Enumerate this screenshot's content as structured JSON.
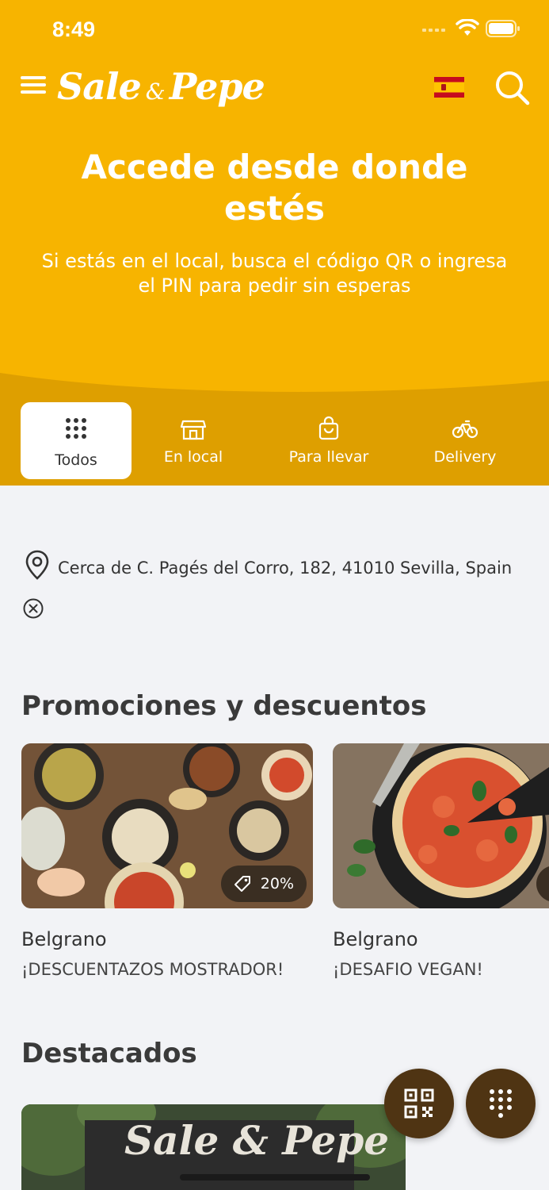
{
  "status_bar": {
    "time": "8:49"
  },
  "header": {
    "logo_text": "Sale",
    "logo_amp": "&",
    "logo_text2": "Pepe",
    "language_flag": "spain-flag-icon",
    "search_icon": "search-icon"
  },
  "hero": {
    "title": "Accede desde donde estés",
    "subtitle": "Si estás en el local, busca el código QR o ingresa el PIN para pedir sin esperas"
  },
  "tabs": [
    {
      "label": "Todos",
      "icon": "grid-icon",
      "active": true
    },
    {
      "label": "En local",
      "icon": "store-icon",
      "active": false
    },
    {
      "label": "Para llevar",
      "icon": "bag-icon",
      "active": false
    },
    {
      "label": "Delivery",
      "icon": "bike-icon",
      "active": false
    }
  ],
  "location": {
    "text": "Cerca de C. Pagés del Corro, 182, 41010 Sevilla, Spain"
  },
  "promotions": {
    "title": "Promociones y descuentos",
    "items": [
      {
        "badge": "20%",
        "name": "Belgrano",
        "description": "¡DESCUENTAZOS MOSTRADOR!"
      },
      {
        "name": "Belgrano",
        "description": "¡DESAFIO VEGAN!"
      }
    ]
  },
  "featured": {
    "title": "Destacados",
    "sign_text": "Sale & Pepe"
  },
  "colors": {
    "brand_yellow": "#F7B400",
    "tab_bar": "#DE9F00",
    "fab_brown": "#4F3413"
  }
}
